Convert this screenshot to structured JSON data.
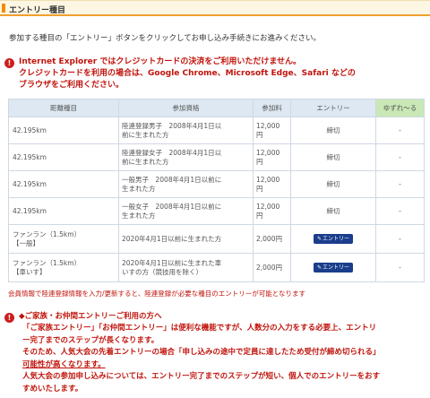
{
  "section": {
    "title": "エントリー種目"
  },
  "intro": "参加する種目の「エントリー」ボタンをクリックしてお申し込み手続きにお進みください。",
  "warning": {
    "icon": "exclamation-icon",
    "lines": [
      "Internet Explorer ではクレジットカードの決済をご利用いただけません。",
      "クレジットカードを利用の場合は、Google Chrome、Microsoft Edge、Safari などの",
      "ブラウザをご利用ください。"
    ]
  },
  "table": {
    "headers": [
      "距離種目",
      "参加資格",
      "参加料",
      "エントリー",
      "ゆずれ～る"
    ],
    "rows": [
      {
        "distance": [
          "42.195km"
        ],
        "qualification": [
          "陸連登録男子　2008年4月1日以",
          "前に生まれた方"
        ],
        "fee": [
          "12,000",
          "円"
        ],
        "entry": "締切",
        "yuzureru": "-"
      },
      {
        "distance": [
          "42.195km"
        ],
        "qualification": [
          "陸連登録女子　2008年4月1日以",
          "前に生まれた方"
        ],
        "fee": [
          "12,000",
          "円"
        ],
        "entry": "締切",
        "yuzureru": "-"
      },
      {
        "distance": [
          "42.195km"
        ],
        "qualification": [
          "一般男子　2008年4月1日以前に",
          "生まれた方"
        ],
        "fee": [
          "12,000",
          "円"
        ],
        "entry": "締切",
        "yuzureru": "-"
      },
      {
        "distance": [
          "42.195km"
        ],
        "qualification": [
          "一般女子　2008年4月1日以前に",
          "生まれた方"
        ],
        "fee": [
          "12,000",
          "円"
        ],
        "entry": "締切",
        "yuzureru": "-"
      },
      {
        "distance": [
          "ファンラン（1.5km）",
          "【一般】"
        ],
        "qualification": [
          "2020年4月1日以前に生まれた方"
        ],
        "fee": [
          "2,000円"
        ],
        "entry_button": "エントリー",
        "yuzureru": "-"
      },
      {
        "distance": [
          "ファンラン（1.5km）",
          "【車いす】"
        ],
        "qualification": [
          "2020年4月1日以前に生まれた車",
          "いすの方（競技用を除く）"
        ],
        "fee": [
          "2,000円"
        ],
        "entry_button": "エントリー",
        "yuzureru": "-"
      }
    ]
  },
  "note": "会員情報で陸連登録情報を入力/更新すると、陸連登録が必要な種目のエントリーが可能となります",
  "family": {
    "icon": "exclamation-icon",
    "heading": "◆ご家族・お仲間エントリーご利用の方へ",
    "lines": [
      "「ご家族エントリー」「お仲間エントリー」は便利な機能ですが、人数分の入力をする必要上、エントリ",
      "ー完了までのステップが長くなります。",
      "そのため、人気大会の先着エントリーの場合「申し込みの途中で定員に達したため受付が締め切られる」",
      "可能性が高くなります。",
      "人気大会の参加申し込みについては、エントリー完了までのステップが短い、個人でのエントリーをおす",
      "すめいたします。"
    ]
  },
  "colors": {
    "accent": "#f08c00",
    "warning_red": "#c0140c",
    "header_blue": "#dde8f3",
    "header_green": "#c9e8b5",
    "button_navy": "#1a3d8c"
  }
}
